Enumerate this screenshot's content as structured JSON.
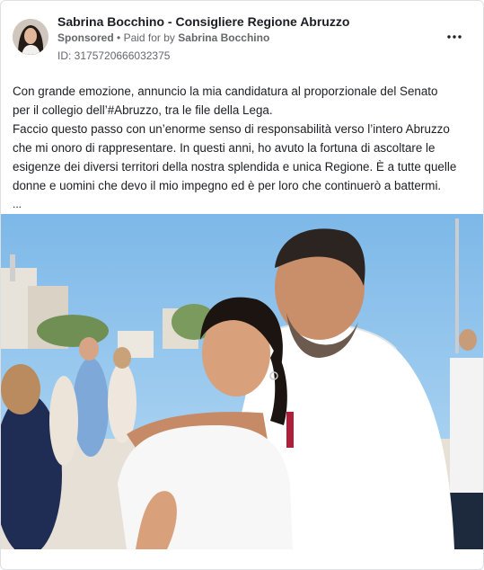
{
  "post": {
    "page_name": "Sabrina Bocchino - Consigliere Regione Abruzzo",
    "sponsored_label": "Sponsored",
    "separator": "•",
    "paid_for_prefix": "Paid for by",
    "paid_for_by": "Sabrina Bocchino",
    "ad_id": "ID: 3175720666032375",
    "more_icon": "more-horizontal-icon",
    "text_lines": [
      "Con grande emozione, annuncio la mia candidatura al proporzionale del Senato",
      "per il collegio dell’#Abruzzo, tra le file della Lega.",
      "Faccio questo passo con un’enorme senso di responsabilità verso l’intero Abruzzo",
      "che mi onoro di rappresentare. In questi anni, ho avuto la fortuna di ascoltare le",
      "esigenze dei diversi territori della nostra splendida e unica Regione. È a tutte quelle",
      "donne e uomini che devo il mio impegno ed è per loro che continuerò a battermi."
    ],
    "truncation": "...",
    "image": "photo-of-candidate-with-politician-at-seaside-promenade"
  },
  "colors": {
    "name_text": "#1c1e21",
    "meta_text": "#65676b",
    "sky": "#8fc3ec",
    "border": "#dddfe2"
  }
}
